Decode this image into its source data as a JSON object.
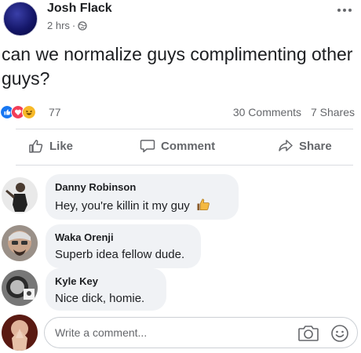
{
  "post": {
    "author": "Josh Flack",
    "time": "2 hrs",
    "separator": "·",
    "text": "can we normalize guys complimenting other guys?",
    "reaction_count": "77",
    "comments_count": "30 Comments",
    "shares_count": "7 Shares",
    "reaction_icons": [
      "like-reaction-icon",
      "love-reaction-icon",
      "haha-reaction-icon"
    ]
  },
  "actions": {
    "like": "Like",
    "comment": "Comment",
    "share": "Share"
  },
  "comments": [
    {
      "author": "Danny Robinson",
      "text": "Hey, you're killin it my guy"
    },
    {
      "author": "Waka Orenji",
      "text": "Superb idea fellow dude."
    },
    {
      "author": "Kyle Key",
      "text": "Nice dick, homie."
    }
  ],
  "composer": {
    "placeholder": "Write a comment..."
  },
  "colors": {
    "like_blue": "#1877f2",
    "love_red": "#f33e58",
    "haha_yellow": "#f7b928",
    "muted_text": "#65676b",
    "bubble_bg": "#f0f2f5"
  }
}
